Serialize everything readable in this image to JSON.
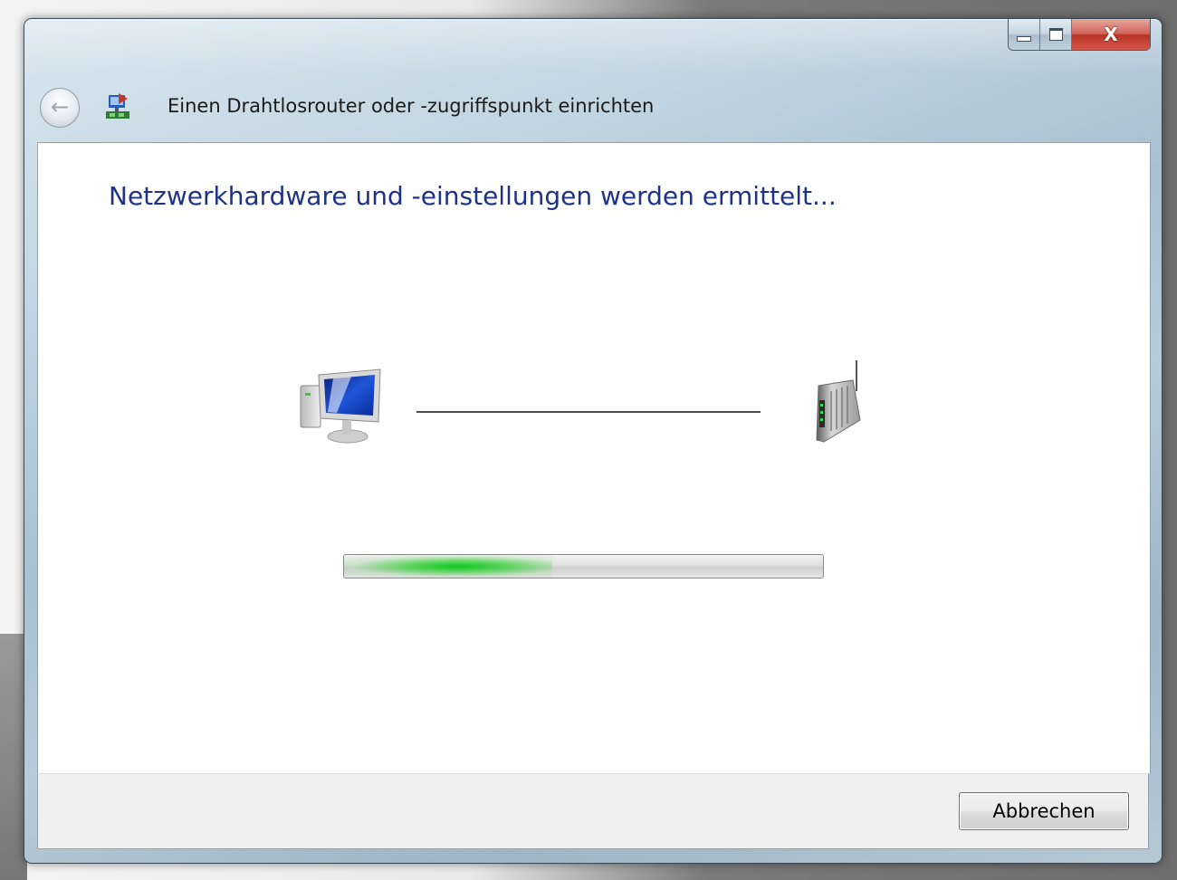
{
  "window": {
    "title": "Einen Drahtlosrouter oder -zugriffspunkt einrichten",
    "caption_buttons": [
      "minimize-icon",
      "maximize-icon",
      "close-icon"
    ],
    "close_label": "X"
  },
  "navigation": {
    "back_icon": "back-arrow-icon",
    "wizard_icon": "network-setup-icon"
  },
  "main": {
    "heading": "Netzwerkhardware und -einstellungen werden ermittelt...",
    "diagram": {
      "left_device_icon": "computer-icon",
      "right_device_icon": "wireless-router-icon"
    },
    "progress": {
      "state": "indeterminate",
      "color": "#1fd22a"
    }
  },
  "footer": {
    "cancel_label": "Abbrechen"
  },
  "colors": {
    "heading": "#1e3287",
    "progress_glow": "#1fd22a",
    "close_button": "#c8453a"
  }
}
